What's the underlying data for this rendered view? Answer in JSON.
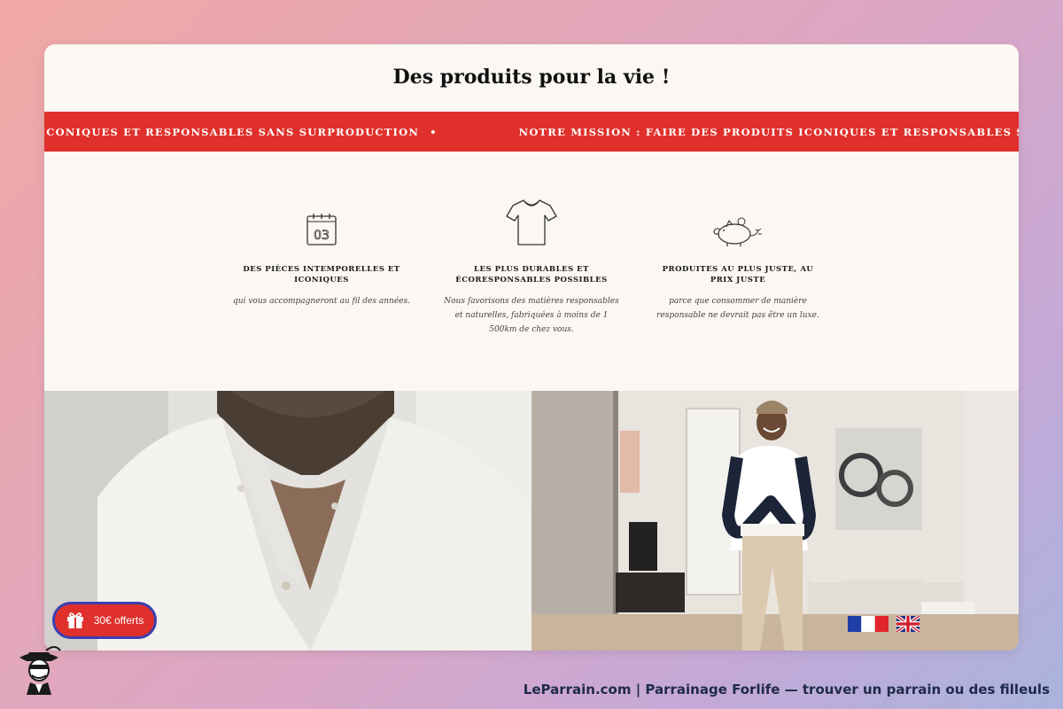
{
  "page": {
    "title": "Des produits pour la vie !"
  },
  "banner": {
    "items": [
      "NOTRE MISSION : FAIRE DES PRODUITS ICONIQUES ET RESPONSABLES SANS SURPRODUCTION",
      "NOTRE MISSION : FAIRE DES PRODUITS ICONIQUES ET RESPONSABLES SANS SURPRODUCTION"
    ],
    "separator": "•",
    "color": "#e0302b"
  },
  "features": [
    {
      "icon": "calendar-icon",
      "calendar_text": "03",
      "heading": "DES PIÈCES INTEMPORELLES ET ICONIQUES",
      "text": "qui vous accompagneront au fil des années."
    },
    {
      "icon": "tshirt-icon",
      "heading": "LES PLUS DURABLES ET ÉCORESPONSABLES POSSIBLES",
      "text": "Nous favorisons des matières responsables et naturelles, fabriquées à moins de 1 500km de chez vous."
    },
    {
      "icon": "piggy-bank-icon",
      "heading": "PRODUITES AU PLUS JUSTE, AU PRIX JUSTE",
      "text": "parce que consommer de manière responsable ne devrait pas être un luxe."
    }
  ],
  "promo": {
    "label": "30€ offerts",
    "icon": "gift-icon"
  },
  "languages": [
    {
      "name": "Français",
      "icon": "flag-fr-icon"
    },
    {
      "name": "English",
      "icon": "flag-uk-icon"
    }
  ],
  "footer": {
    "text": "LeParrain.com | Parrainage Forlife — trouver un parrain ou des filleuls"
  }
}
